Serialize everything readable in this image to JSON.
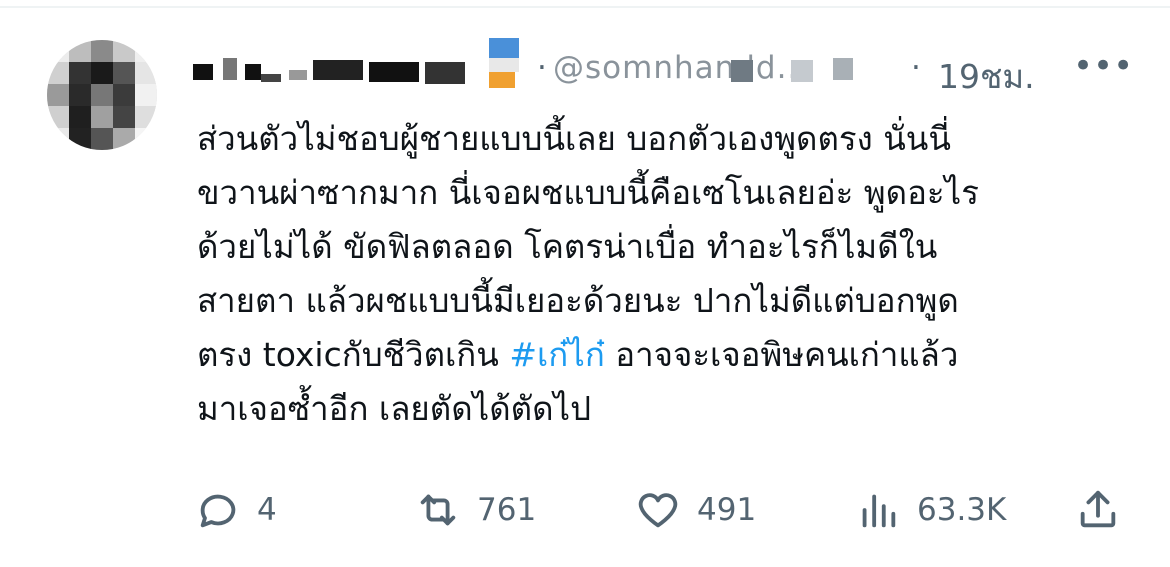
{
  "tweet": {
    "author_handle": "@somnhandd...",
    "separator": "·",
    "timestamp": "19ชม.",
    "more_label": "•••",
    "text_lines": [
      "ส่วนตัวไม่ชอบผู้ชายแบบนี้เลย บอกตัวเองพูดตรง นั่นนี่",
      "ขวานผ่าซากมาก นี่เจอผชแบบนี้คือเซโนเลยอ่ะ พูดอะไร",
      "ด้วยไม่ได้ ขัดฟิลตลอด โคตรน่าเบื่อ ทำอะไรก็ไมดีใน",
      "สายตา แล้วผชแบบนี้มีเยอะด้วยนะ ปากไม่ดีแต่บอกพูด",
      "มาเจอซ้ำอีก เลยตัดได้ตัดไป"
    ],
    "line5": {
      "before": "ตรง toxicกับชีวิตเกิน ",
      "hashtag": "#เก๋ไก๋",
      "after": "  อาจจะเจอพิษคนเก่าแล้ว"
    }
  },
  "actions": {
    "reply_count": "4",
    "retweet_count": "761",
    "like_count": "491",
    "views_count": "63.3K"
  },
  "icons": {
    "reply": "reply-bubble-icon",
    "retweet": "retweet-icon",
    "like": "heart-icon",
    "views": "views-chart-icon",
    "share": "share-icon"
  },
  "colors": {
    "accent": "#1d9bf0",
    "secondary_text": "#536471",
    "primary_text": "#0f1419"
  }
}
